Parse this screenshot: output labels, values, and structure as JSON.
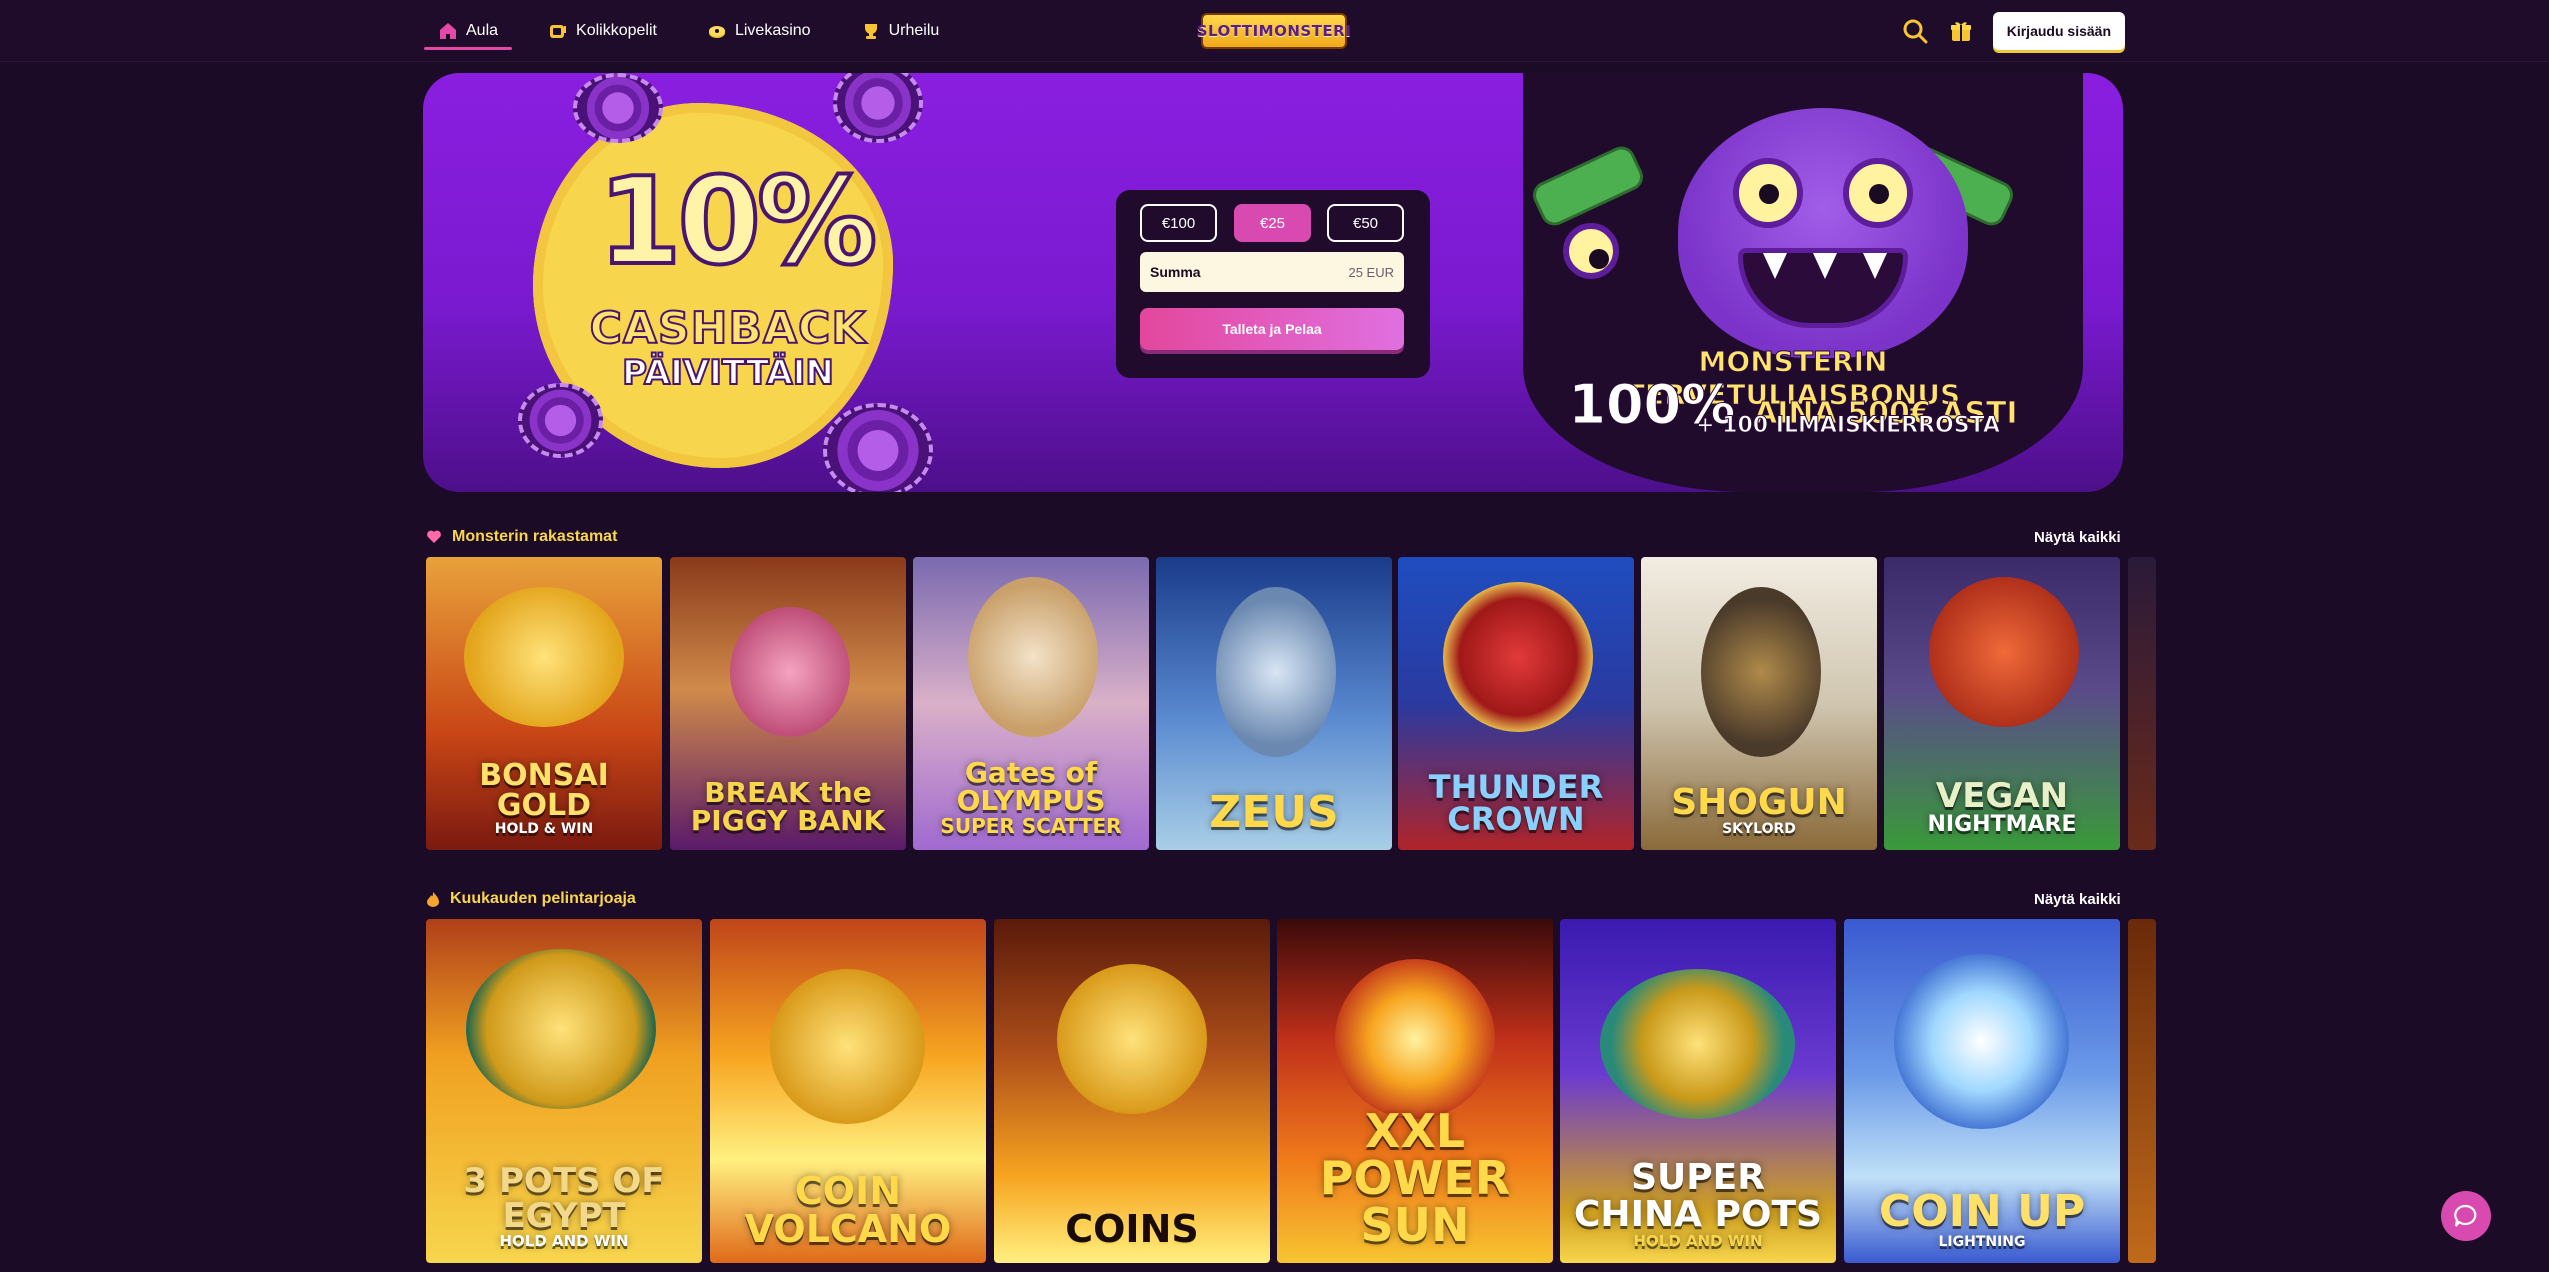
{
  "header": {
    "nav": [
      {
        "label": "Aula",
        "icon": "home-icon"
      },
      {
        "label": "Kolikkopelit",
        "icon": "slots-icon"
      },
      {
        "label": "Livekasino",
        "icon": "live-casino-icon"
      },
      {
        "label": "Urheilu",
        "icon": "sports-icon"
      }
    ],
    "logo_text": "SLOTTIMONSTERI",
    "login_label": "Kirjaudu sisään"
  },
  "hero": {
    "cashback_big": "10%",
    "cashback_line1": "CASHBACK",
    "cashback_line2": "PÄIVITTÄIN",
    "amounts": [
      "€100",
      "€25",
      "€50"
    ],
    "selected_amount": "€25",
    "sum_label": "Summa",
    "sum_value": "25 EUR",
    "deposit_label": "Talleta ja Pelaa",
    "bonus_line1": "MONSTERIN TERVETULIAISBONUS",
    "bonus_line2a": "100%",
    "bonus_line2b": "AINA 500€ ASTI",
    "bonus_line3": "+ 100 ILMAISKIERROSTA"
  },
  "sections": [
    {
      "title": "Monsterin rakastamat",
      "see_all": "Näytä kaikki",
      "games": [
        {
          "title": "BONSAI GOLD",
          "sub": "HOLD & WIN"
        },
        {
          "title": "BREAK the PIGGY BANK",
          "sub": ""
        },
        {
          "title": "Gates of OLYMPUS",
          "sub": "SUPER SCATTER"
        },
        {
          "title": "ZEUS",
          "sub": ""
        },
        {
          "title": "THUNDER CROWN",
          "sub": ""
        },
        {
          "title": "SHOGUN",
          "sub": "SKYLORD"
        },
        {
          "title": "VEGAN",
          "sub": "NIGHTMARE"
        }
      ]
    },
    {
      "title": "Kuukauden pelintarjoaja",
      "see_all": "Näytä kaikki",
      "games": [
        {
          "title": "3 POTS OF EGYPT",
          "sub": "HOLD AND WIN"
        },
        {
          "title": "COIN VOLCANO",
          "sub": ""
        },
        {
          "title": "COINS",
          "sub": ""
        },
        {
          "title": "XXL POWER SUN",
          "sub": ""
        },
        {
          "title": "SUPER CHINA POTS",
          "sub": "HOLD AND WIN"
        },
        {
          "title": "COIN UP",
          "sub": "LIGHTNING"
        }
      ]
    }
  ],
  "colors": {
    "background": "#1c0b26",
    "accent_pink": "#d94ab0",
    "accent_yellow": "#f7d64d",
    "hero_purple": "#8a1ee0"
  }
}
